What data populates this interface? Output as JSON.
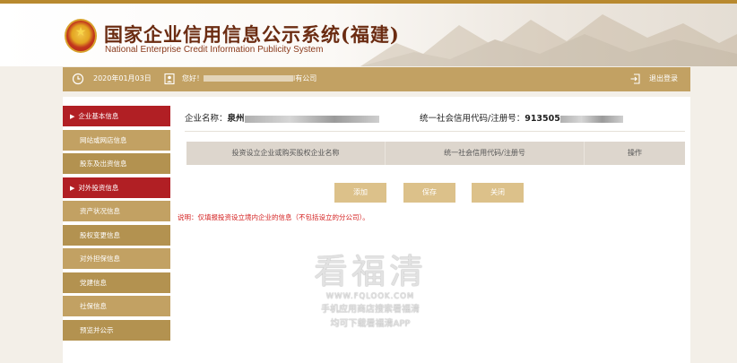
{
  "header": {
    "title_cn": "国家企业信用信息公示系统(福建)",
    "title_en": "National Enterprise Credit Information Publicity System"
  },
  "infobar": {
    "date": "2020年01月03日",
    "greeting_prefix": "您好！",
    "greeting_suffix": "l有公司",
    "logout": "退出登录"
  },
  "sidebar": {
    "items": [
      {
        "label": "企业基本信息",
        "active": true
      },
      {
        "label": "网站或网店信息"
      },
      {
        "label": "股东及出资信息"
      },
      {
        "label": "对外投资信息",
        "active": true
      },
      {
        "label": "资产状况信息"
      },
      {
        "label": "股权变更信息"
      },
      {
        "label": "对外担保信息"
      },
      {
        "label": "党建信息"
      },
      {
        "label": "社保信息"
      },
      {
        "label": "预览并公示"
      }
    ]
  },
  "main": {
    "company_name_label": "企业名称：",
    "company_name_value": "泉州",
    "credit_code_label": "统一社会信用代码/注册号：",
    "credit_code_value": "913505",
    "table_headers": [
      "投资设立企业或购买股权企业名称",
      "统一社会信用代码/注册号",
      "操作"
    ],
    "buttons": {
      "add": "添加",
      "save": "保存",
      "close": "关闭"
    },
    "note": "说明：仅填报投资设立境内企业的信息（不包括设立的分公司）。"
  },
  "watermark": {
    "big": "看福清",
    "url": "WWW.FQLOOK.COM",
    "line1": "手机应用商店搜索看福清",
    "line2": "均可下载看福清APP"
  },
  "colors": {
    "accent_gold": "#c2a163",
    "active_red": "#b11f24",
    "button_gold": "#dcc18a",
    "note_red": "#d42020"
  }
}
